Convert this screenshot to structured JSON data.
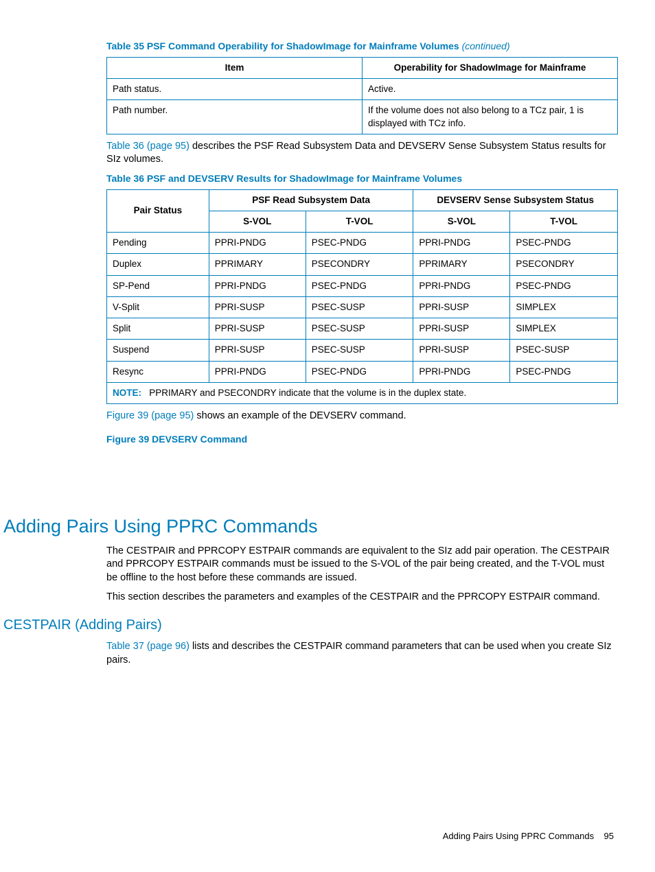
{
  "table35": {
    "title_prefix": "Table 35 PSF Command Operability for ShadowImage for Mainframe Volumes ",
    "title_suffix": "(continued)",
    "headers": [
      "Item",
      "Operability for ShadowImage for Mainframe"
    ],
    "rows": [
      [
        "Path status.",
        "Active."
      ],
      [
        "Path number.",
        "If the volume does not also belong to a TCz pair, 1 is displayed with TCz info."
      ]
    ]
  },
  "para1_link": "Table 36 (page 95)",
  "para1_rest": " describes the PSF Read Subsystem Data and DEVSERV Sense Subsystem Status results for SIz volumes.",
  "table36": {
    "title": "Table 36 PSF and DEVSERV Results for ShadowImage for Mainframe Volumes",
    "header_row1": [
      "Pair Status",
      "PSF Read Subsystem Data",
      "DEVSERV Sense Subsystem Status"
    ],
    "header_row2": [
      "S-VOL",
      "T-VOL",
      "S-VOL",
      "T-VOL"
    ],
    "rows": [
      [
        "Pending",
        "PPRI-PNDG",
        "PSEC-PNDG",
        "PPRI-PNDG",
        "PSEC-PNDG"
      ],
      [
        "Duplex",
        "PPRIMARY",
        "PSECONDRY",
        "PPRIMARY",
        "PSECONDRY"
      ],
      [
        "SP-Pend",
        "PPRI-PNDG",
        "PSEC-PNDG",
        "PPRI-PNDG",
        "PSEC-PNDG"
      ],
      [
        "V-Split",
        "PPRI-SUSP",
        "PSEC-SUSP",
        "PPRI-SUSP",
        "SIMPLEX"
      ],
      [
        "Split",
        "PPRI-SUSP",
        "PSEC-SUSP",
        "PPRI-SUSP",
        "SIMPLEX"
      ],
      [
        "Suspend",
        "PPRI-SUSP",
        "PSEC-SUSP",
        "PPRI-SUSP",
        "PSEC-SUSP"
      ],
      [
        "Resync",
        "PPRI-PNDG",
        "PSEC-PNDG",
        "PPRI-PNDG",
        "PSEC-PNDG"
      ]
    ],
    "note_label": "NOTE:",
    "note_text": "PPRIMARY and PSECONDRY indicate that the volume is in the duplex state."
  },
  "para2_link": "Figure 39 (page 95)",
  "para2_rest": " shows an example of the DEVSERV command.",
  "figure39_title": "Figure 39 DEVSERV Command",
  "section_h1": "Adding Pairs Using PPRC Commands",
  "section_p1": "The CESTPAIR and PPRCOPY ESTPAIR commands are equivalent to the SIz add pair operation. The CESTPAIR and PPRCOPY ESTPAIR commands must be issued to the S-VOL of the pair being created, and the T-VOL must be offline to the host before these commands are issued.",
  "section_p2": "This section describes the parameters and examples of the CESTPAIR and the PPRCOPY ESTPAIR command.",
  "subsection_h2": "CESTPAIR (Adding Pairs)",
  "sub_p_link": "Table 37 (page 96)",
  "sub_p_rest": " lists and describes the CESTPAIR command parameters that can be used when you create SIz pairs.",
  "footer_text": "Adding Pairs Using PPRC Commands",
  "footer_page": "95"
}
